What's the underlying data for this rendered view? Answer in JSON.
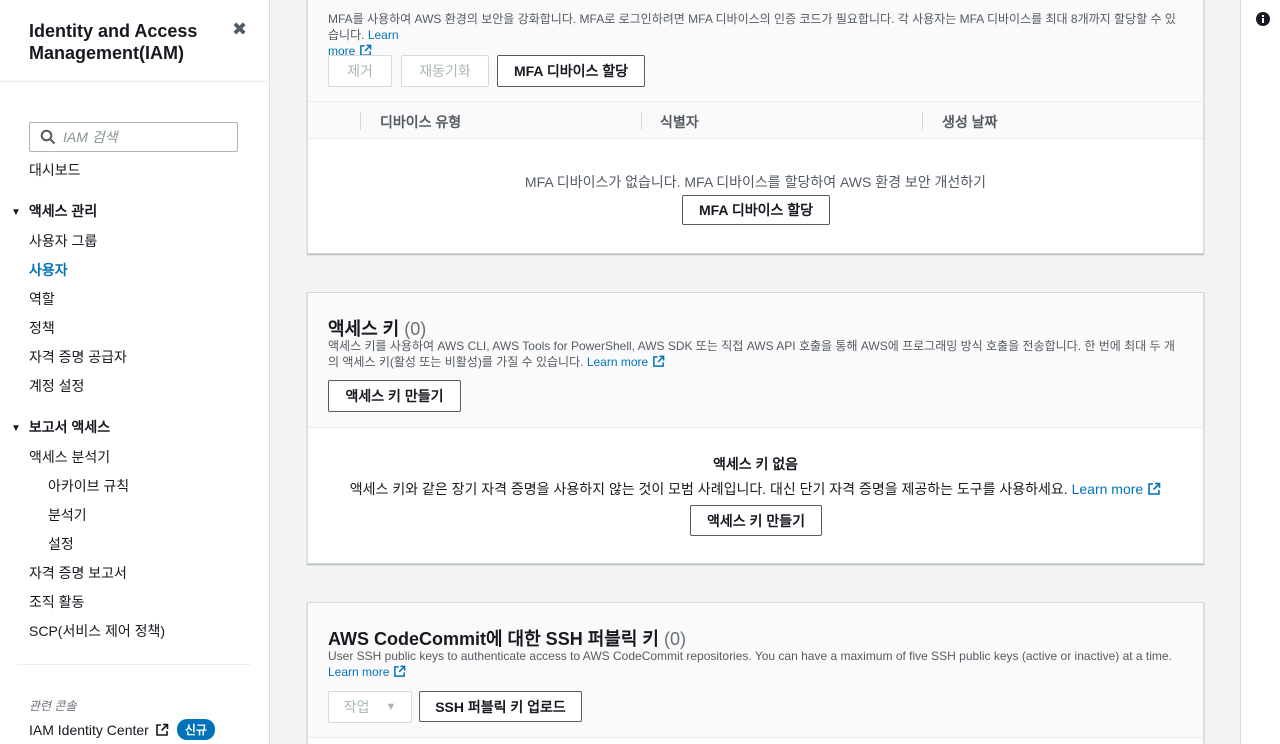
{
  "sidebar": {
    "title": "Identity and Access Management(IAM)",
    "search_placeholder": "IAM 검색",
    "dashboard": "대시보드",
    "access_management": {
      "label": "액세스 관리",
      "items": [
        "사용자 그룹",
        "사용자",
        "역할",
        "정책",
        "자격 증명 공급자",
        "계정 설정"
      ]
    },
    "report_access": {
      "label": "보고서 액세스",
      "items": [
        "액세스 분석기",
        "아카이브 규칙",
        "분석기",
        "설정",
        "자격 증명 보고서",
        "조직 활동",
        "SCP(서비스 제어 정책)"
      ]
    },
    "related_label": "관련 콘솔",
    "identity_center": "IAM Identity Center",
    "new_badge": "신규"
  },
  "mfa": {
    "desc": "MFA를 사용하여 AWS 환경의 보안을 강화합니다. MFA로 로그인하려면 MFA 디바이스의 인증 코드가 필요합니다. 각 사용자는 MFA 디바이스를 최대 8개까지 할당할 수 있습니다.",
    "learn_more_1": "Learn",
    "learn_more_2": "more",
    "remove_btn": "제거",
    "resync_btn": "재동기화",
    "assign_btn": "MFA 디바이스 할당",
    "columns": [
      "디바이스 유형",
      "식별자",
      "생성 날짜"
    ],
    "empty_text": "MFA 디바이스가 없습니다. MFA 디바이스를 할당하여 AWS 환경 보안 개선하기",
    "empty_assign_btn": "MFA 디바이스 할당"
  },
  "access_keys": {
    "title": "액세스 키",
    "count": "(0)",
    "desc": "액세스 키를 사용하여 AWS CLI, AWS Tools for PowerShell, AWS SDK 또는 직접 AWS API 호출을 통해 AWS에 프로그래밍 방식 호출을 전송합니다. 한 번에 최대 두 개의 액세스 키(활성 또는 비활성)를 가질 수 있습니다.",
    "learn_more": "Learn more",
    "create_btn": "액세스 키 만들기",
    "empty_title": "액세스 키 없음",
    "empty_desc": "액세스 키와 같은 장기 자격 증명을 사용하지 않는 것이 모범 사례입니다. 대신 단기 자격 증명을 제공하는 도구를 사용하세요.",
    "empty_learn_more": "Learn more",
    "empty_create_btn": "액세스 키 만들기"
  },
  "ssh_keys": {
    "title": "AWS CodeCommit에 대한 SSH 퍼블릭 키",
    "count": "(0)",
    "desc": "User SSH public keys to authenticate access to AWS CodeCommit repositories. You can have a maximum of five SSH public keys (active or inactive) at a time.",
    "learn_more": "Learn more",
    "actions_btn": "작업",
    "upload_btn": "SSH 퍼블릭 키 업로드"
  },
  "colors": {
    "accent": "#0073bb",
    "text": "#16191f",
    "muted": "#545b64",
    "border": "#d5dbdb"
  },
  "icons": [
    "close-icon",
    "search-icon",
    "external-link-icon",
    "info-icon",
    "caret-down-icon"
  ]
}
